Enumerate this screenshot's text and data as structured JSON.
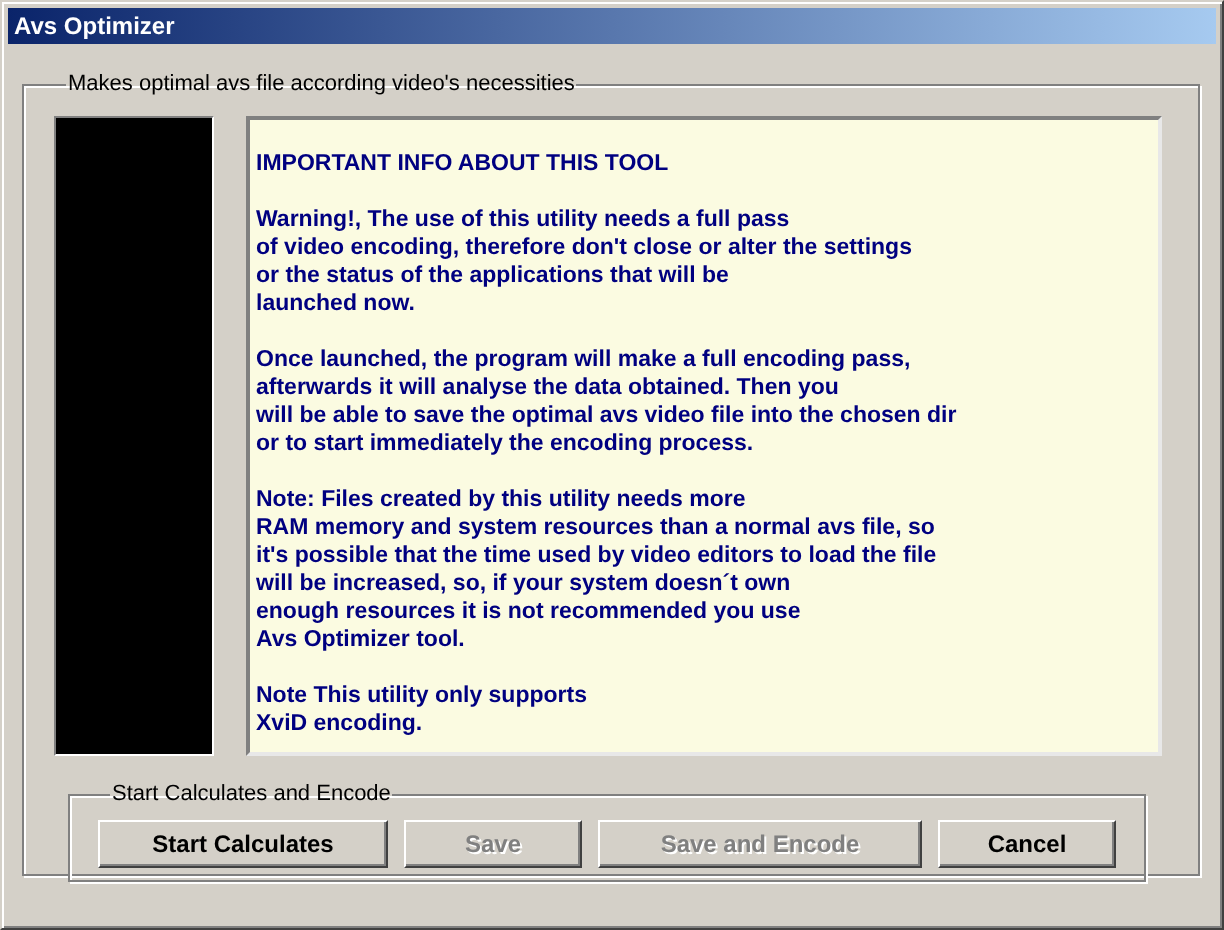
{
  "window": {
    "title": "Avs Optimizer"
  },
  "main_group": {
    "label": "Makes optimal avs file according video's necessities"
  },
  "info": {
    "heading": "IMPORTANT INFO ABOUT THIS TOOL",
    "paragraphs": [
      "Warning!, The use of this utility needs a full pass\nof video encoding, therefore don't close or alter the settings\nor the status of the applications that will be\nlaunched now.",
      "Once launched, the program will make a full encoding pass,\nafterwards it will analyse the data obtained. Then you\nwill be able to save the optimal avs video file into the chosen dir\nor to start immediately the encoding process.",
      "Note: Files created by this utility needs more\nRAM memory and system resources than a normal avs file, so\nit's possible that the time used by video editors to load the file\nwill be increased, so, if your system doesn´t own\nenough resources it is not recommended you use\nAvs Optimizer tool.",
      "Note This utility only supports\nXviD encoding."
    ]
  },
  "action_group": {
    "label": "Start Calculates and Encode",
    "buttons": [
      {
        "label": "Start Calculates",
        "disabled": false
      },
      {
        "label": "Save",
        "disabled": true
      },
      {
        "label": "Save and Encode",
        "disabled": true
      },
      {
        "label": "Cancel",
        "disabled": false
      }
    ]
  }
}
